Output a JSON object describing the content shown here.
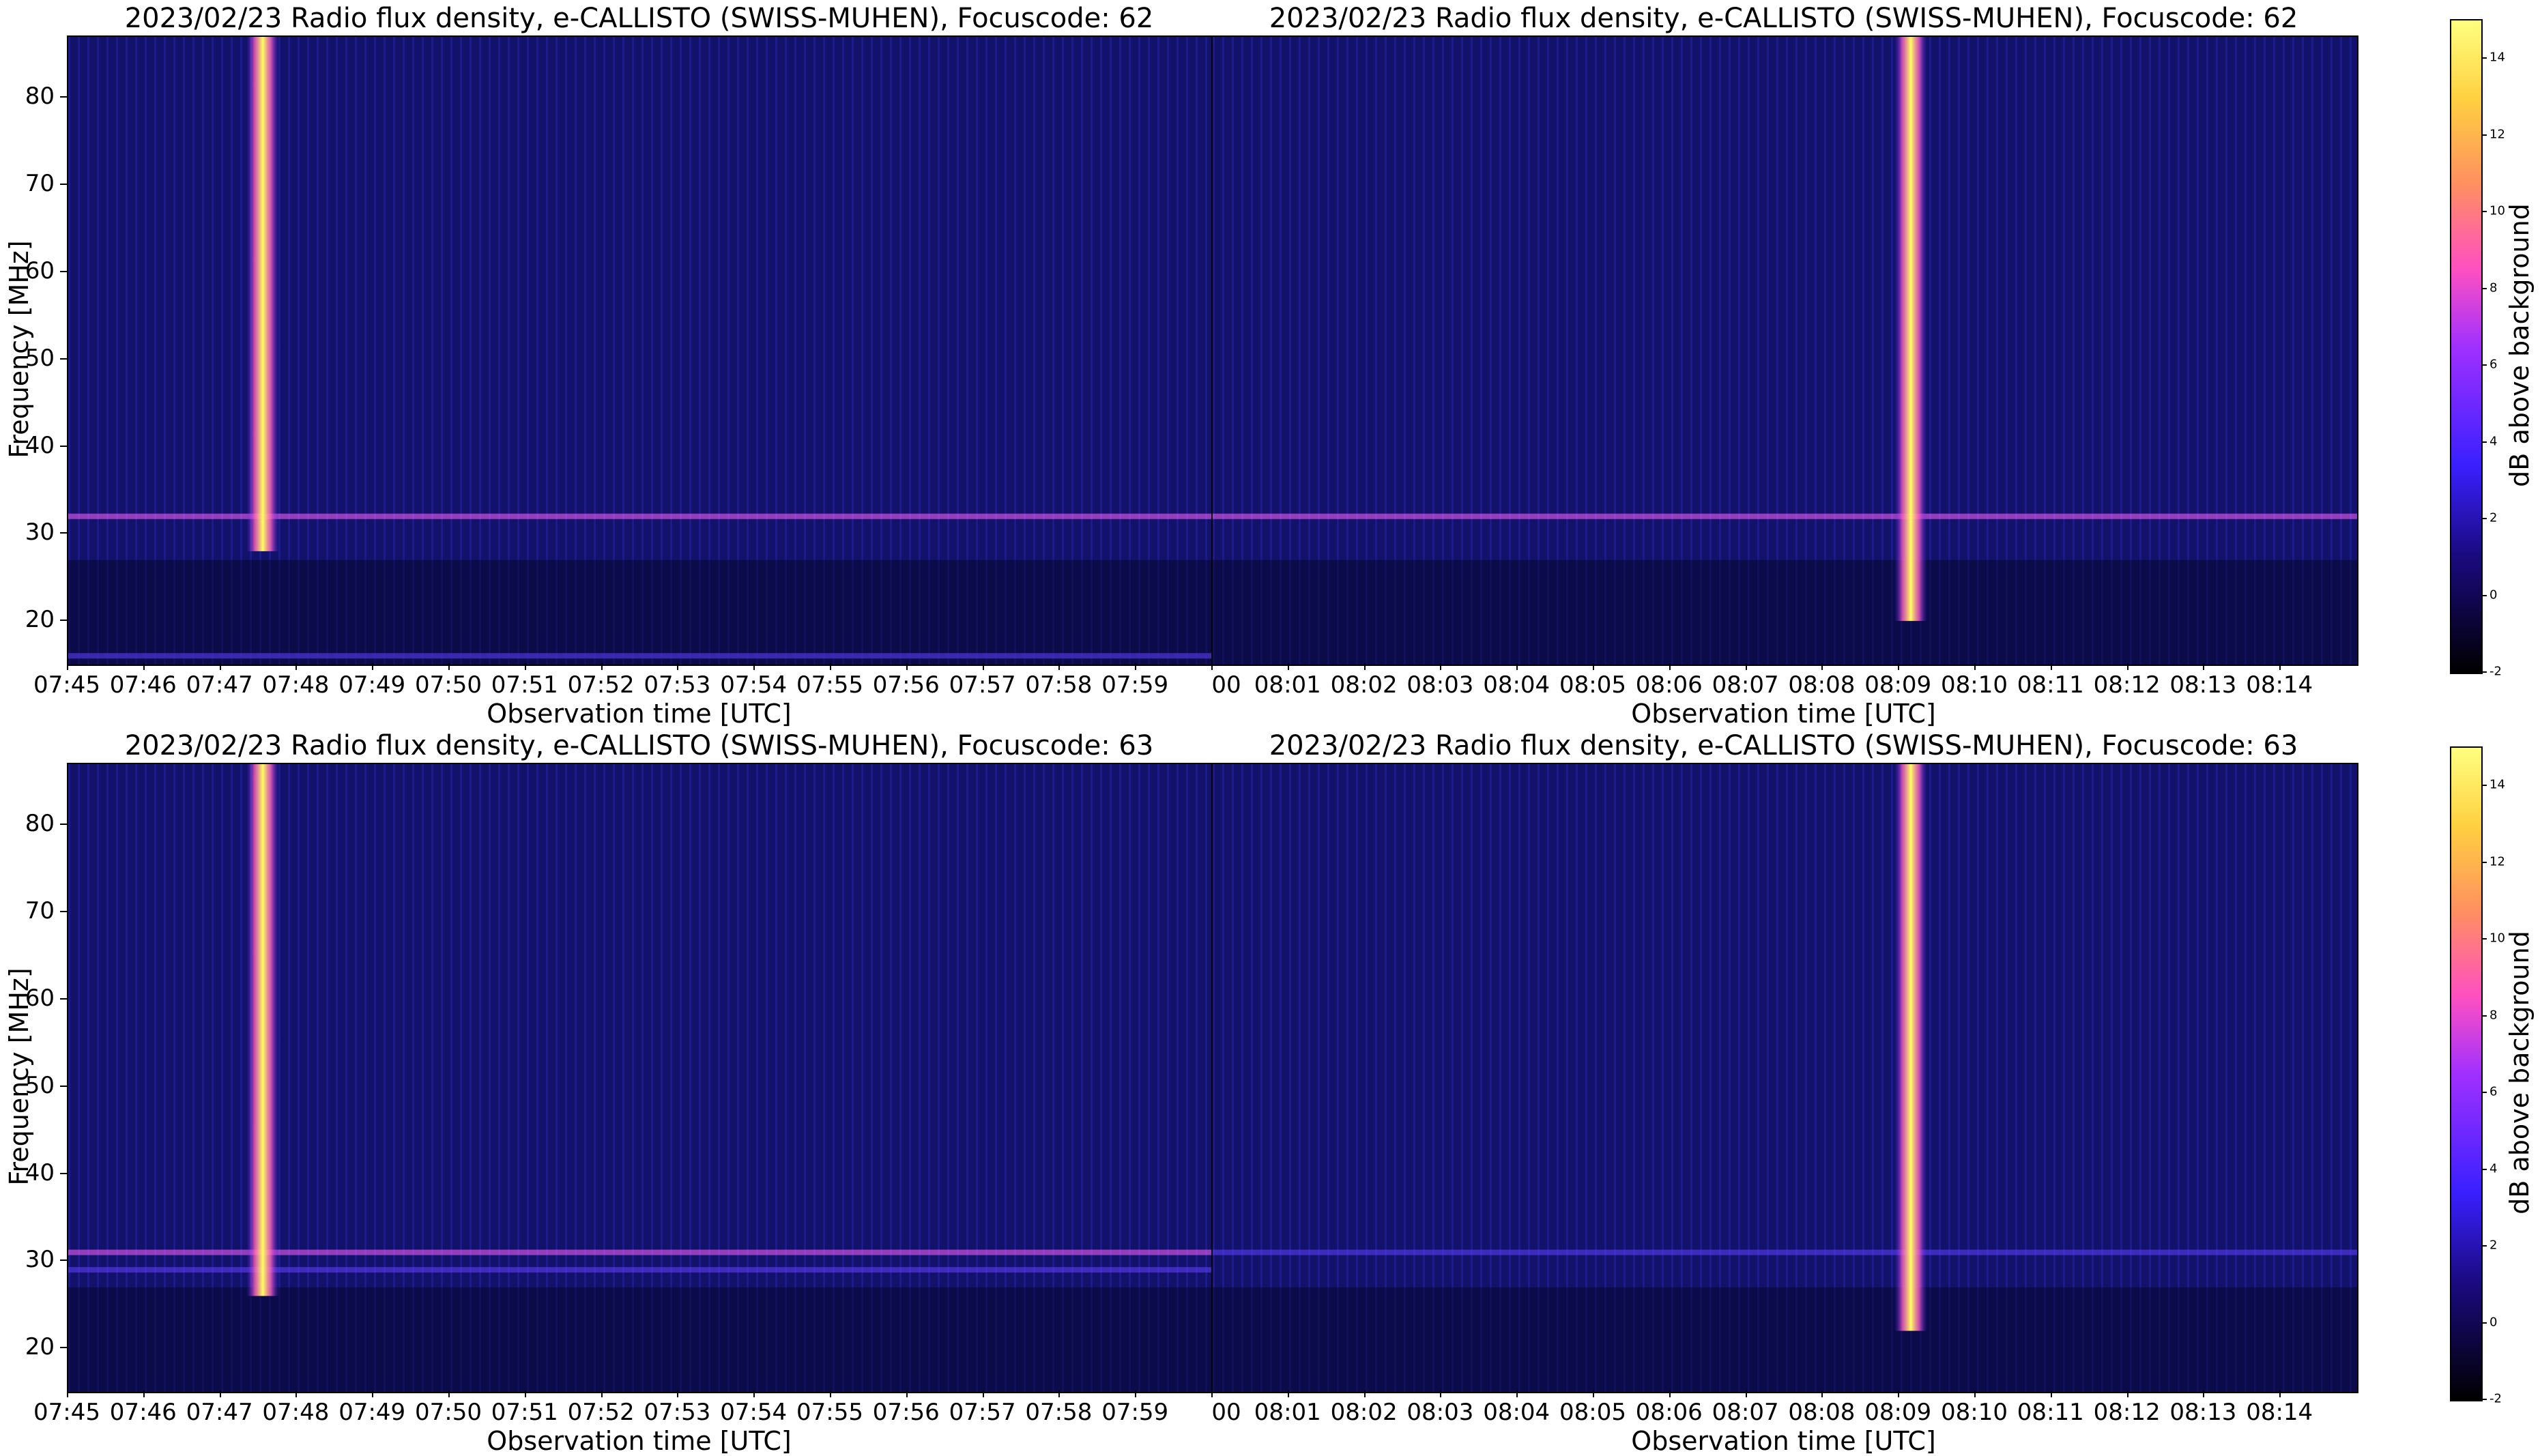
{
  "colors": {
    "background": "#12126a",
    "burst_core": "#ffff40",
    "burst_edge": "#ff8040",
    "band": "#ff60ff"
  },
  "colorbar": {
    "label": "dB above background",
    "ticks": [
      "-2",
      "0",
      "2",
      "4",
      "6",
      "8",
      "10",
      "12",
      "14"
    ],
    "colormap": "gnuplot2"
  },
  "chart_data": [
    {
      "type": "heatmap",
      "title": "2023/02/23  Radio flux density, e-CALLISTO (SWISS-MUHEN), Focuscode: 62",
      "xlabel": "Observation time [UTC]",
      "ylabel": "Frequency [MHz]",
      "xticks": [
        "07:45",
        "07:46",
        "07:47",
        "07:48",
        "07:49",
        "07:50",
        "07:51",
        "07:52",
        "07:53",
        "07:54",
        "07:55",
        "07:56",
        "07:57",
        "07:58",
        "07:59"
      ],
      "ylim": [
        15,
        87
      ],
      "yticks": [
        20,
        30,
        40,
        50,
        60,
        70,
        80
      ],
      "burst": {
        "time_frac": 0.17,
        "freq_range": [
          28,
          87
        ],
        "peak_db": 14
      },
      "bands": [
        {
          "freq": 32,
          "db": 6
        },
        {
          "freq": 16,
          "db": 4
        }
      ]
    },
    {
      "type": "heatmap",
      "title": "2023/02/23  Radio flux density, e-CALLISTO (SWISS-MUHEN), Focuscode: 62",
      "xlabel": "Observation time [UTC]",
      "xticks": [
        "00",
        "08:01",
        "08:02",
        "08:03",
        "08:04",
        "08:05",
        "08:06",
        "08:07",
        "08:08",
        "08:09",
        "08:10",
        "08:11",
        "08:12",
        "08:13",
        "08:14"
      ],
      "ylim": [
        15,
        87
      ],
      "burst": {
        "time_frac": 0.61,
        "freq_range": [
          20,
          87
        ],
        "peak_db": 14
      },
      "bands": [
        {
          "freq": 32,
          "db": 6
        }
      ]
    },
    {
      "type": "heatmap",
      "title": "2023/02/23  Radio flux density, e-CALLISTO (SWISS-MUHEN), Focuscode: 63",
      "xlabel": "Observation time [UTC]",
      "ylabel": "Frequency [MHz]",
      "xticks": [
        "07:45",
        "07:46",
        "07:47",
        "07:48",
        "07:49",
        "07:50",
        "07:51",
        "07:52",
        "07:53",
        "07:54",
        "07:55",
        "07:56",
        "07:57",
        "07:58",
        "07:59"
      ],
      "ylim": [
        15,
        87
      ],
      "yticks": [
        20,
        30,
        40,
        50,
        60,
        70,
        80
      ],
      "burst": {
        "time_frac": 0.17,
        "freq_range": [
          26,
          87
        ],
        "peak_db": 14
      },
      "bands": [
        {
          "freq": 31,
          "db": 6
        },
        {
          "freq": 29,
          "db": 5
        }
      ]
    },
    {
      "type": "heatmap",
      "title": "2023/02/23  Radio flux density, e-CALLISTO (SWISS-MUHEN), Focuscode: 63",
      "xlabel": "Observation time [UTC]",
      "xticks": [
        "00",
        "08:01",
        "08:02",
        "08:03",
        "08:04",
        "08:05",
        "08:06",
        "08:07",
        "08:08",
        "08:09",
        "08:10",
        "08:11",
        "08:12",
        "08:13",
        "08:14"
      ],
      "ylim": [
        15,
        87
      ],
      "burst": {
        "time_frac": 0.61,
        "freq_range": [
          22,
          87
        ],
        "peak_db": 14
      },
      "bands": [
        {
          "freq": 31,
          "db": 4
        }
      ]
    }
  ]
}
